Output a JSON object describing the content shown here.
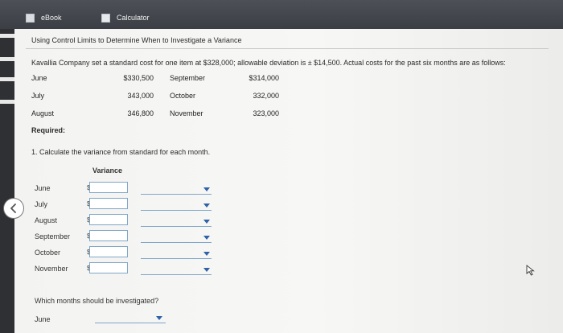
{
  "tabs": {
    "ebook": "eBook",
    "calculator": "Calculator"
  },
  "title": "Using Control Limits to Determine When to Investigate a Variance",
  "intro": "Kavallia Company set a standard cost for one item at $328,000; allowable deviation is ± $14,500. Actual costs for the past six months are as follows:",
  "costs": [
    {
      "m1": "June",
      "v1": "$330,500",
      "m2": "September",
      "v2": "$314,000"
    },
    {
      "m1": "July",
      "v1": "343,000",
      "m2": "October",
      "v2": "332,000"
    },
    {
      "m1": "August",
      "v1": "346,800",
      "m2": "November",
      "v2": "323,000"
    }
  ],
  "required": "Required:",
  "question1": "1. Calculate the variance from standard for each month.",
  "variance_header": "Variance",
  "variance_rows": [
    {
      "month": "June",
      "currency": "$",
      "value": "",
      "selection": ""
    },
    {
      "month": "July",
      "currency": "$",
      "value": "",
      "selection": ""
    },
    {
      "month": "August",
      "currency": "$",
      "value": "",
      "selection": ""
    },
    {
      "month": "September",
      "currency": "$",
      "value": "",
      "selection": ""
    },
    {
      "month": "October",
      "currency": "$",
      "value": "",
      "selection": ""
    },
    {
      "month": "November",
      "currency": "$",
      "value": "",
      "selection": ""
    }
  ],
  "question2": "Which months should be investigated?",
  "investigate_rows": [
    {
      "month": "June",
      "selection": ""
    }
  ],
  "colors": {
    "accent": "#2f62a8",
    "input_border": "#7fa6c9",
    "tabbar": "#40444a"
  }
}
